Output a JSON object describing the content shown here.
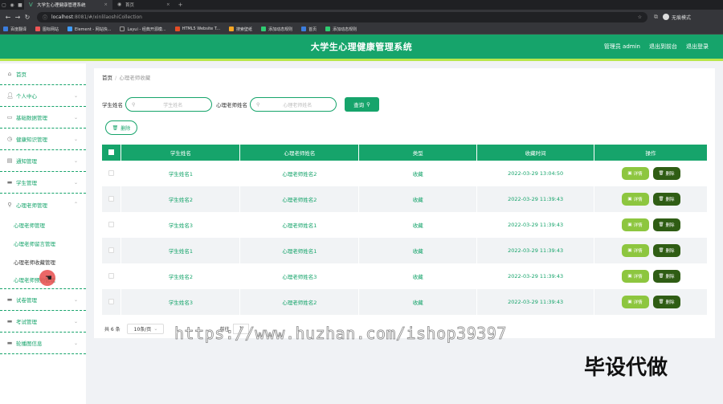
{
  "browser": {
    "tab_active_title": "大学生心理健康管理系统",
    "tab_second_title": "首页",
    "url_host": "localhost",
    "url_rest": ":8081/#/xinlilaoshiCollection",
    "profile_label": "无痕模式",
    "bookmarks": [
      "百度翻译",
      "图标网站",
      "Element - 网站快...",
      "Layui - 经典开源模...",
      "HTML5 Website T...",
      "搜索壁纸",
      "添加动态规则",
      "首页",
      "添加动态规则"
    ]
  },
  "header": {
    "title": "大学生心理健康管理系统",
    "user": "管理员 admin",
    "to_front": "退出到前台",
    "logout": "退出登录"
  },
  "sidebar": {
    "items": [
      {
        "label": "首页",
        "icon": "home-icon"
      },
      {
        "label": "个人中心",
        "icon": "user-icon"
      },
      {
        "label": "基础数据管理",
        "icon": "chat-icon"
      },
      {
        "label": "健康知识管理",
        "icon": "clock-icon"
      },
      {
        "label": "通知管理",
        "icon": "doc-icon"
      },
      {
        "label": "学生管理",
        "icon": "card-icon"
      },
      {
        "label": "心理老师管理",
        "icon": "search-icon"
      }
    ],
    "sub_items": [
      "心理老师管理",
      "心理老师留言管理",
      "心理老师收藏管理",
      "心理老师预约管理"
    ],
    "bottom_items": [
      {
        "label": "试卷管理",
        "icon": "card-icon"
      },
      {
        "label": "考试管理",
        "icon": "card-icon"
      },
      {
        "label": "轮播图信息",
        "icon": "card-icon"
      }
    ]
  },
  "breadcrumb": {
    "home": "首页",
    "current": "心理老师收藏"
  },
  "search": {
    "student_label": "学生姓名",
    "student_placeholder": "学生姓名",
    "teacher_label": "心理老师姓名",
    "teacher_placeholder": "心理老师姓名",
    "query_label": "查询"
  },
  "delete_label": "删除",
  "table": {
    "headers": [
      "学生姓名",
      "心理老师姓名",
      "类型",
      "收藏时间",
      "操作"
    ],
    "rows": [
      [
        "学生姓名1",
        "心理老师姓名2",
        "收藏",
        "2022-03-29 13:04:50"
      ],
      [
        "学生姓名2",
        "心理老师姓名2",
        "收藏",
        "2022-03-29 11:39:43"
      ],
      [
        "学生姓名3",
        "心理老师姓名1",
        "收藏",
        "2022-03-29 11:39:43"
      ],
      [
        "学生姓名1",
        "心理老师姓名1",
        "收藏",
        "2022-03-29 11:39:43"
      ],
      [
        "学生姓名2",
        "心理老师姓名3",
        "收藏",
        "2022-03-29 11:39:43"
      ],
      [
        "学生姓名3",
        "心理老师姓名2",
        "收藏",
        "2022-03-29 11:39:43"
      ]
    ],
    "detail_label": "详情",
    "delete_label": "删除"
  },
  "pager": {
    "total": "共 6 条",
    "page_size": "10条/页",
    "goto_label": "前往",
    "page": "1"
  },
  "overlay": {
    "watermark": "https://www.huzhan.com/ishop39397",
    "caption": "毕设代做"
  },
  "colors": {
    "primary": "#16a46b",
    "accent_bar": "#b9e64b",
    "detail_btn": "#8dc63f",
    "delete_btn": "#2f5d14"
  }
}
